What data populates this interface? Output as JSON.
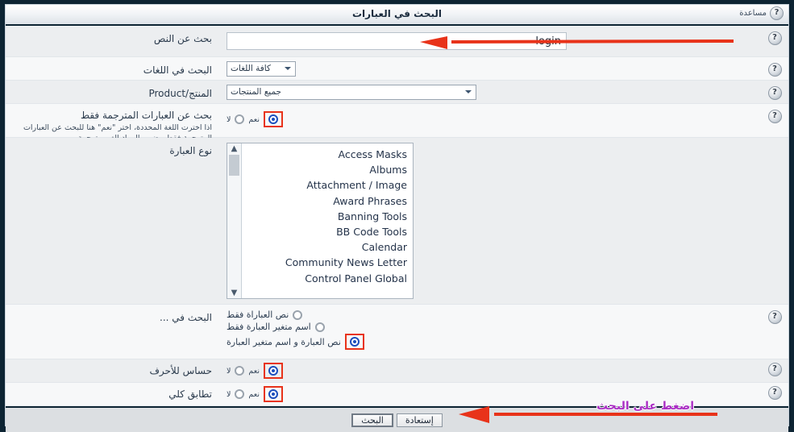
{
  "window": {
    "title": "البحث في العبارات",
    "help_label": "مساعدة",
    "help_icon": "question-mark-icon"
  },
  "rows": {
    "search_text": {
      "label": "بحث عن النص",
      "value": "login"
    },
    "search_languages": {
      "label": "البحث في اللغات",
      "selected": "كافة اللغات"
    },
    "product": {
      "label": "المنتج/Product",
      "selected": "جميع المنتجات"
    },
    "translated_only": {
      "label": "بحث عن العبارات المترجمة فقط",
      "sub": "اذا اخترت اللغة المحددة، اختر \"نعم\" هنا للبحث عن العبارات المترجمة فقط بيضمن المواد الغير مترجمة.",
      "yes_label": "نعم",
      "no_label": "لا",
      "selected": "yes"
    },
    "phrase_type": {
      "label": "نوع العبارة",
      "items": [
        "Access Masks",
        "Albums",
        "Attachment / Image",
        "Award Phrases",
        "Banning Tools",
        "BB Code Tools",
        "Calendar",
        "Community News Letter",
        "Control Panel Global"
      ]
    },
    "search_in": {
      "label": "البحث في ...",
      "options": [
        "نص العباراة فقط",
        "اسم متغير العبارة فقط",
        "نص العبارة و اسم متغير العبارة"
      ],
      "selected_index": 2
    },
    "case_sensitive": {
      "label": "حساس للأحرف",
      "yes_label": "نعم",
      "no_label": "لا",
      "selected": "yes"
    },
    "exact_match": {
      "label": "تطابق كلي",
      "yes_label": "نعم",
      "no_label": "لا",
      "selected": "yes"
    }
  },
  "footer": {
    "search_button": "البحث",
    "reset_button": "إستعادة"
  },
  "annotations": {
    "search_field_note": "",
    "click_search_note": "اضغط على البحث",
    "arrow_color": "#e8331a",
    "note_color": "#aa2fc4",
    "highlight_color": "#e8331a"
  }
}
